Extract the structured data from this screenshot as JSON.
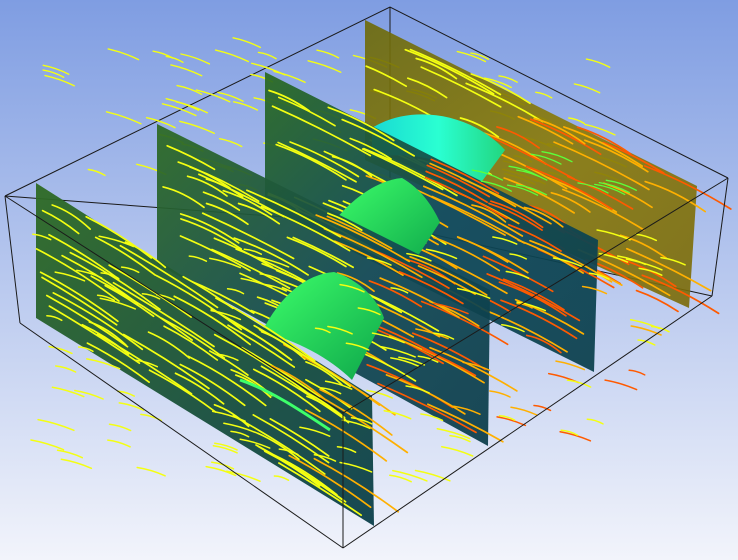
{
  "scene": {
    "background_top": "#7f9de2",
    "background_bottom": "#f2f4fb",
    "box_edge_color": "#1a1a1a",
    "plane_color_dark": "#0b4a50",
    "plane_color_mid": "#2a6a2a",
    "plane_tint": "#8a8a00",
    "blade_color_light": "#3dff6a",
    "blade_color_dark": "#0ea64a",
    "blade_cyan": "#2affd2",
    "streamline_colors": {
      "slow": "#f4ff12",
      "mid": "#ffb000",
      "fast": "#ff5a00",
      "wake": "#5cff3a"
    }
  }
}
